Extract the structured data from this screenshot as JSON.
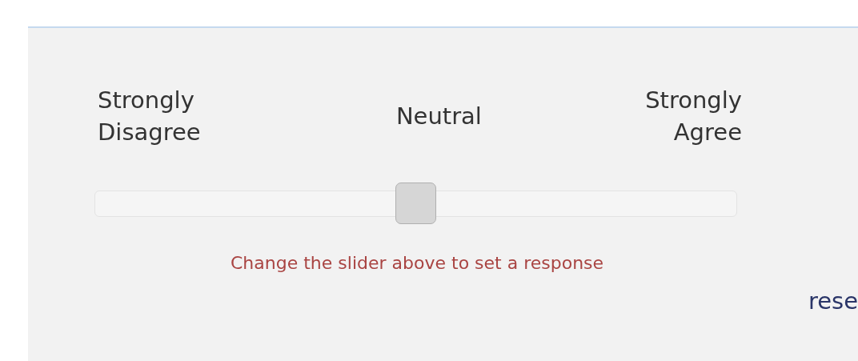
{
  "scale": {
    "low_label": "Strongly\nDisagree",
    "mid_label": "Neutral",
    "high_label": "Strongly\nAgree"
  },
  "slider": {
    "level": 0.5
  },
  "hint": "Change the slider above to set a response",
  "reset_link": "rese"
}
